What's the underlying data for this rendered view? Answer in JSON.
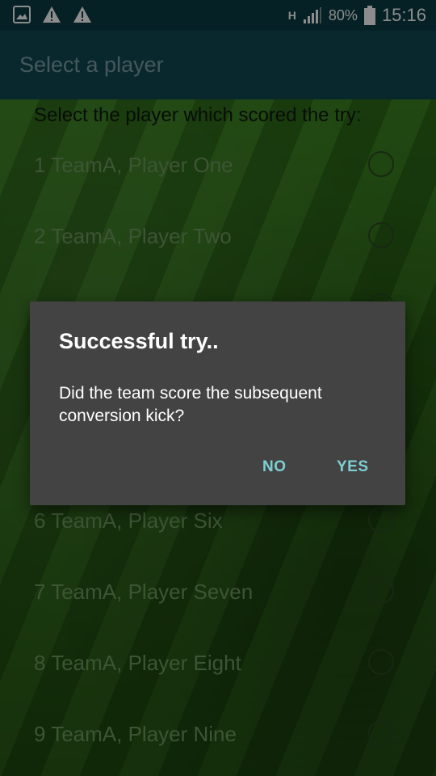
{
  "status_bar": {
    "left_icons": [
      "gallery-icon",
      "warning-icon",
      "warning-icon"
    ],
    "network": "H",
    "battery": "80%",
    "time": "15:16"
  },
  "app_bar": {
    "title": "Select a player"
  },
  "prompt": "Select the player which scored the try:",
  "players": [
    {
      "label": "1 TeamA, Player One"
    },
    {
      "label": "2 TeamA, Player Two"
    },
    {
      "label": ""
    },
    {
      "label": ""
    },
    {
      "label": ""
    },
    {
      "label": "6 TeamA, Player Six"
    },
    {
      "label": "7 TeamA, Player Seven"
    },
    {
      "label": "8 TeamA, Player Eight"
    },
    {
      "label": "9 TeamA, Player Nine"
    }
  ],
  "dialog": {
    "title": "Successful try..",
    "message": "Did the team score the subsequent conversion kick?",
    "no_label": "NO",
    "yes_label": "YES"
  },
  "colors": {
    "app_bar": "#0f4a55",
    "status_bar": "#0b3c44",
    "dialog": "#434343",
    "accent": "#7ecfd2"
  }
}
